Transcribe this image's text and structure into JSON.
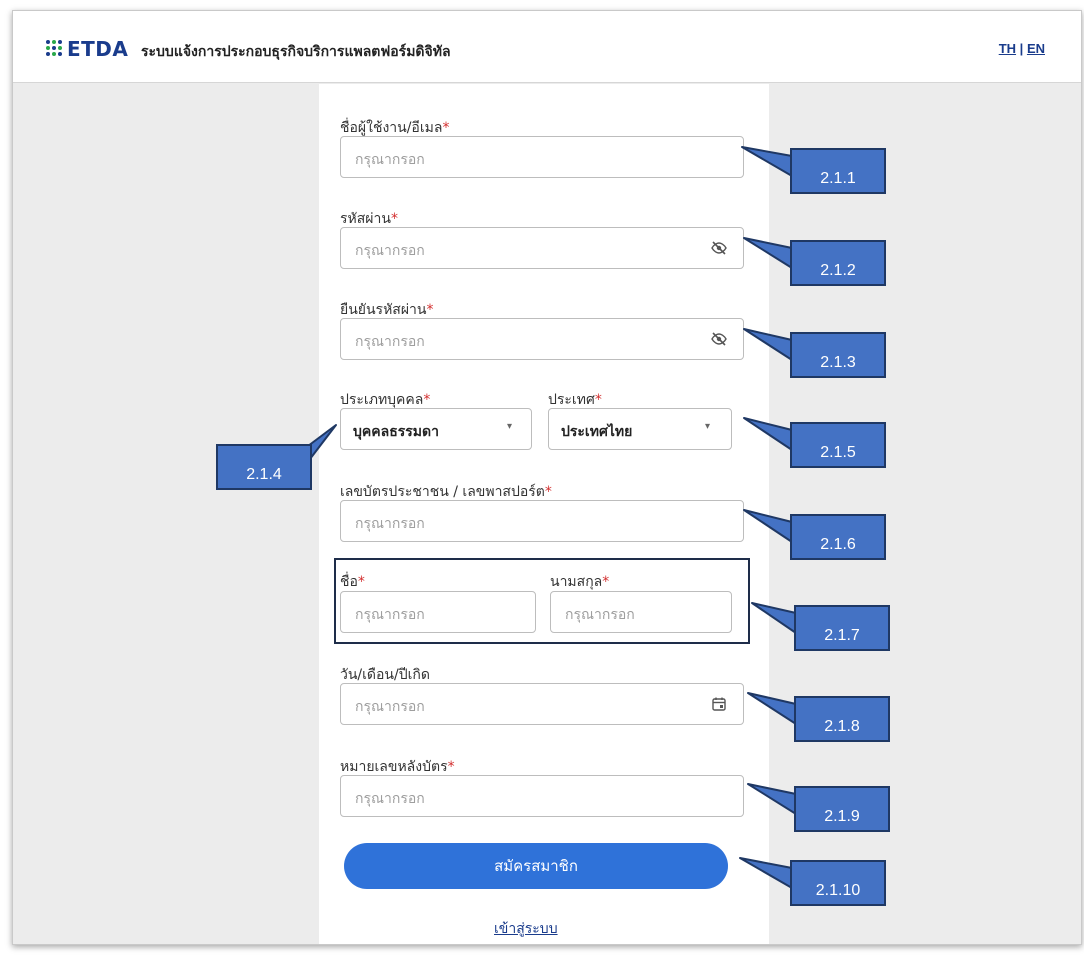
{
  "header": {
    "logo_text": "ETDA",
    "app_title": "ระบบแจ้งการประกอบธุรกิจบริการแพลตฟอร์มดิจิทัล",
    "lang_th": "TH",
    "lang_sep": "|",
    "lang_en": "EN"
  },
  "form": {
    "required_mark": "*",
    "username": {
      "label": "ชื่อผู้ใช้งาน/อีเมล",
      "placeholder": "กรุณากรอก"
    },
    "password": {
      "label": "รหัสผ่าน",
      "placeholder": "กรุณากรอก",
      "icon": "eye-off-icon"
    },
    "confirm_password": {
      "label": "ยืนยันรหัสผ่าน",
      "placeholder": "กรุณากรอก",
      "icon": "eye-off-icon"
    },
    "person_type": {
      "label": "ประเภทบุคคล",
      "value": "บุคคลธรรมดา"
    },
    "country": {
      "label": "ประเทศ",
      "value": "ประเทศไทย"
    },
    "id_number": {
      "label": "เลขบัตรประชาชน / เลขพาสปอร์ต",
      "placeholder": "กรุณากรอก"
    },
    "first_name": {
      "label": "ชื่อ",
      "placeholder": "กรุณากรอก"
    },
    "last_name": {
      "label": "นามสกุล",
      "placeholder": "กรุณากรอก"
    },
    "birth_date": {
      "label": "วัน/เดือน/ปีเกิด",
      "placeholder": "กรุณากรอก",
      "icon": "calendar-icon"
    },
    "card_back_number": {
      "label": "หมายเลขหลังบัตร",
      "placeholder": "กรุณากรอก"
    },
    "submit_label": "สมัครสมาชิก",
    "login_link": "เข้าสู่ระบบ"
  },
  "callouts": [
    "2.1.1",
    "2.1.2",
    "2.1.3",
    "2.1.4",
    "2.1.5",
    "2.1.6",
    "2.1.7",
    "2.1.8",
    "2.1.9",
    "2.1.10"
  ],
  "colors": {
    "brand": "#1a3c8c",
    "required": "#d32f2f",
    "primary_button": "#2f72d9",
    "callout_fill": "#4472c4",
    "callout_border": "#1f3864"
  }
}
